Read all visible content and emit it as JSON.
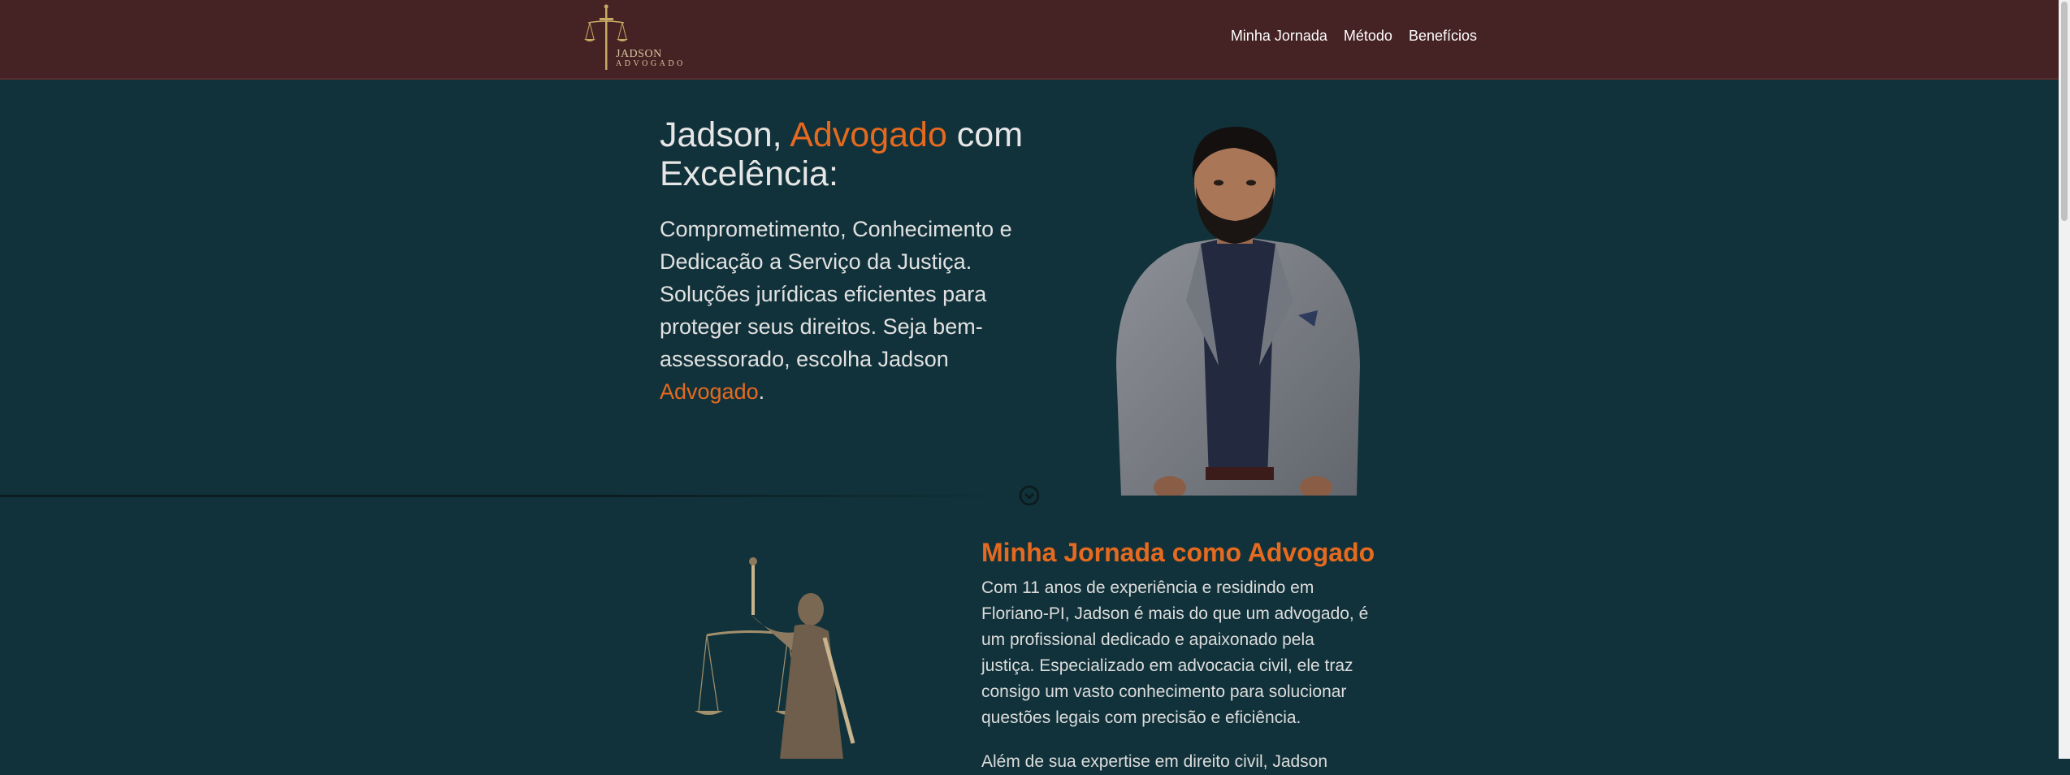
{
  "header": {
    "logo_name": "JADSON",
    "logo_subtitle": "ADVOGADO",
    "nav": [
      {
        "label": "Minha Jornada"
      },
      {
        "label": "Método"
      },
      {
        "label": "Benefícios"
      }
    ]
  },
  "hero": {
    "title_part1": "Jadson, ",
    "title_accent": "Advogado",
    "title_part2": " com Excelência:",
    "description": "Comprometimento, Conhecimento e Dedicação a Serviço da Justiça. Soluções jurídicas eficientes para proteger seus direitos. Seja bem-assessorado, escolha Jadson ",
    "description_accent": "Advogado",
    "description_end": "."
  },
  "journey": {
    "title": "Minha Jornada como Advogado",
    "paragraph1": "Com 11 anos de experiência e residindo em Floriano-PI, Jadson é mais do que um advogado, é um profissional dedicado e apaixonado pela justiça. Especializado em advocacia civil, ele traz consigo um vasto conhecimento para solucionar questões legais com precisão e eficiência.",
    "paragraph2": "Além de sua expertise em direito civil, Jadson"
  },
  "colors": {
    "header_bg": "#452223",
    "page_bg": "#11323a",
    "accent": "#e56a1f"
  },
  "icons": {
    "logo": "sword-scales-icon",
    "scroll": "chevron-down-circle-icon"
  }
}
